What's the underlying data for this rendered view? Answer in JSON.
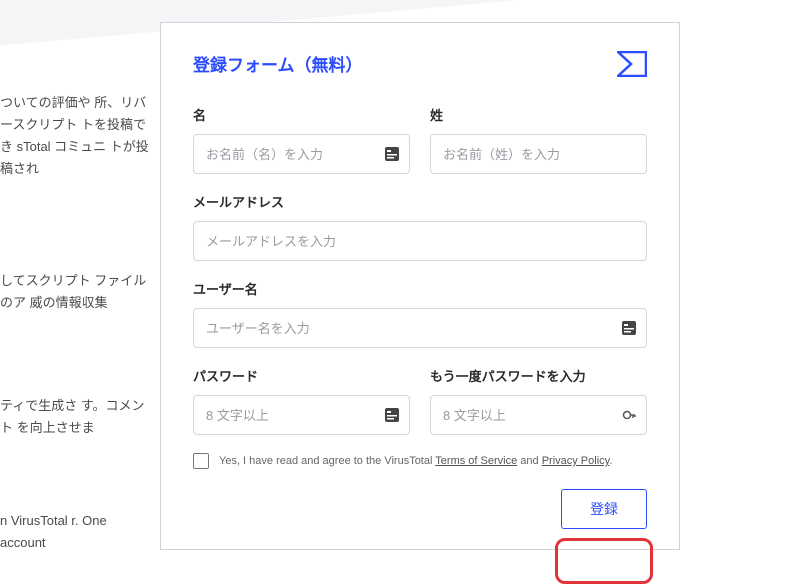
{
  "background": {
    "block1": "ついての評価や\n所、リバースクリプト\nトを投稿でき\nsTotal コミュニ\nトが投稿され",
    "block2": "してスクリプト\nファイルのア\n威の情報収集",
    "block3": "ティで生成さ\nす。コメント\nを向上させま",
    "block4": "n VirusTotal\nr. One account"
  },
  "modal": {
    "title": "登録フォーム（無料）"
  },
  "fields": {
    "first_name": {
      "label": "名",
      "placeholder": "お名前（名）を入力"
    },
    "last_name": {
      "label": "姓",
      "placeholder": "お名前（姓）を入力"
    },
    "email": {
      "label": "メールアドレス",
      "placeholder": "メールアドレスを入力"
    },
    "username": {
      "label": "ユーザー名",
      "placeholder": "ユーザー名を入力"
    },
    "password": {
      "label": "パスワード",
      "placeholder": "8 文字以上"
    },
    "password_confirm": {
      "label": "もう一度パスワードを入力",
      "placeholder": "8 文字以上"
    }
  },
  "agreement": {
    "prefix": "Yes, I have read and agree to the VirusTotal ",
    "tos": "Terms of Service",
    "mid": " and ",
    "privacy": "Privacy Policy",
    "suffix": "."
  },
  "actions": {
    "submit": "登録"
  }
}
